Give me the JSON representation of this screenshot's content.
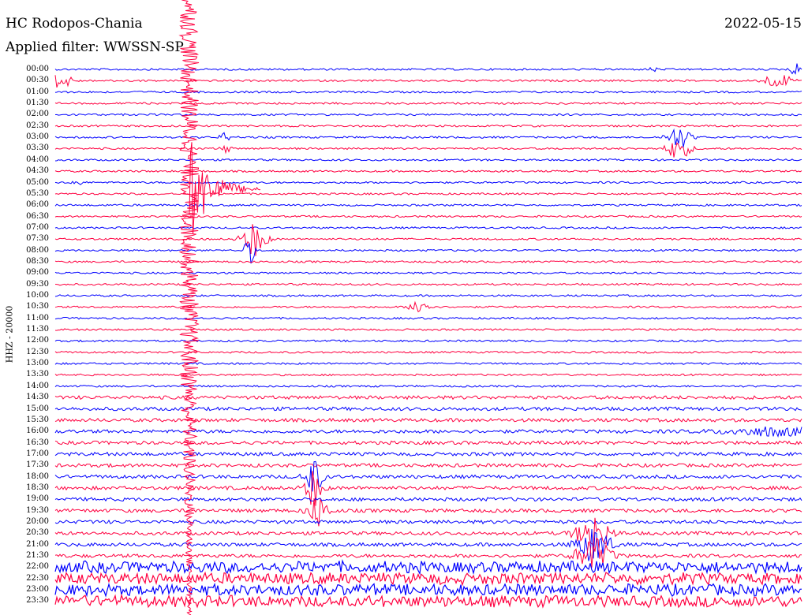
{
  "header": {
    "station": "HC Rodopos-Chania",
    "filter": "Applied filter: WWSSN-SP",
    "date": "2022-05-15"
  },
  "chart_data": {
    "type": "line",
    "title": "HC Rodopos-Chania",
    "channel_label": "HHZ - 20000",
    "time_labels": [
      "00:00",
      "00:30",
      "01:00",
      "01:30",
      "02:00",
      "02:30",
      "03:00",
      "03:30",
      "04:00",
      "04:30",
      "05:00",
      "05:30",
      "06:00",
      "06:30",
      "07:00",
      "07:30",
      "08:00",
      "08:30",
      "09:00",
      "09:30",
      "10:00",
      "10:30",
      "11:00",
      "11:30",
      "12:00",
      "12:30",
      "13:00",
      "13:30",
      "14:00",
      "14:30",
      "15:00",
      "15:30",
      "16:00",
      "16:30",
      "17:00",
      "17:30",
      "18:00",
      "18:30",
      "19:00",
      "19:30",
      "20:00",
      "20:30",
      "21:00",
      "21:30",
      "22:00",
      "22:30",
      "23:00",
      "23:30"
    ],
    "trace_colors": [
      "#0000ff",
      "#ff0040"
    ],
    "events": [
      {
        "label": "00:00 end burst",
        "x_fraction": 0.99,
        "amplitude": 10
      },
      {
        "label": "00:30 start burst",
        "x_fraction": 0.01,
        "amplitude": 12
      },
      {
        "label": "00:30 end burst",
        "x_fraction": 0.97,
        "amplitude": 8
      },
      {
        "label": "03:00 bursts",
        "x_fraction": 0.86,
        "amplitude": 16
      },
      {
        "label": "05:00 spike",
        "x_fraction": 0.03,
        "amplitude": 12
      },
      {
        "label": "05:00-05:30 large event",
        "x_fraction": 0.24,
        "amplitude": 370
      },
      {
        "label": "07:30 event",
        "x_fraction": 0.3,
        "amplitude": 40
      },
      {
        "label": "10:30 event",
        "x_fraction": 0.52,
        "amplitude": 12
      },
      {
        "label": "17:30 event",
        "x_fraction": 0.39,
        "amplitude": 60
      },
      {
        "label": "21:00 event",
        "x_fraction": 0.73,
        "amplitude": 45
      },
      {
        "label": "22:30-23:30 noise",
        "x_fraction": 0.5,
        "amplitude": 10
      }
    ]
  }
}
